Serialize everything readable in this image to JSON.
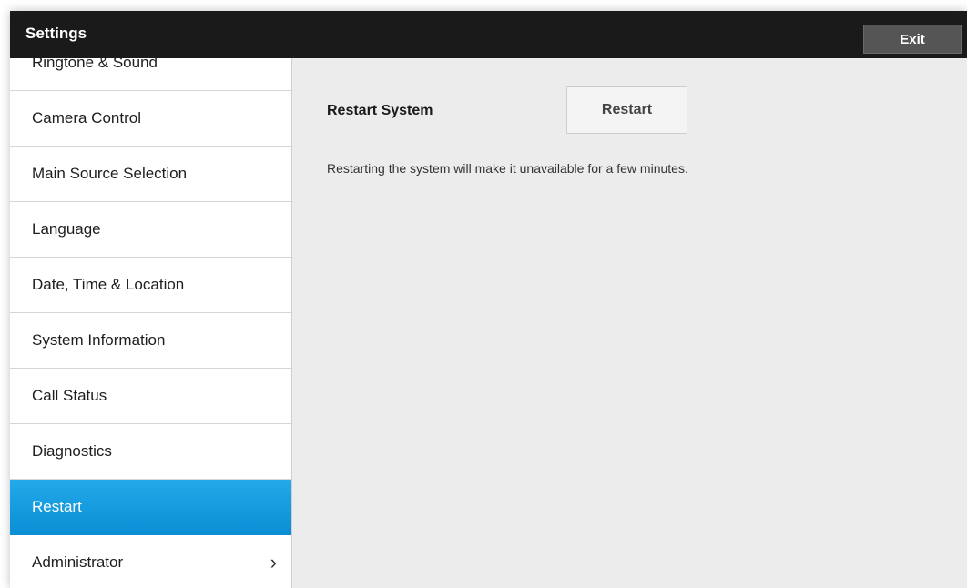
{
  "titlebar": {
    "title": "Settings",
    "exit_label": "Exit"
  },
  "sidebar": {
    "items": [
      {
        "label": "Ringtone & Sound"
      },
      {
        "label": "Camera Control"
      },
      {
        "label": "Main Source Selection"
      },
      {
        "label": "Language"
      },
      {
        "label": "Date, Time & Location"
      },
      {
        "label": "System Information"
      },
      {
        "label": "Call Status"
      },
      {
        "label": "Diagnostics"
      },
      {
        "label": "Restart",
        "active": true
      },
      {
        "label": "Administrator",
        "chevron": "chevron-right-icon"
      }
    ]
  },
  "main": {
    "section_label": "Restart System",
    "button_label": "Restart",
    "description": "Restarting the system will make it unavailable for a few minutes."
  },
  "colors": {
    "titlebar": "#1a1a1a",
    "active": "#0f9be0",
    "content_bg": "#ececec"
  }
}
